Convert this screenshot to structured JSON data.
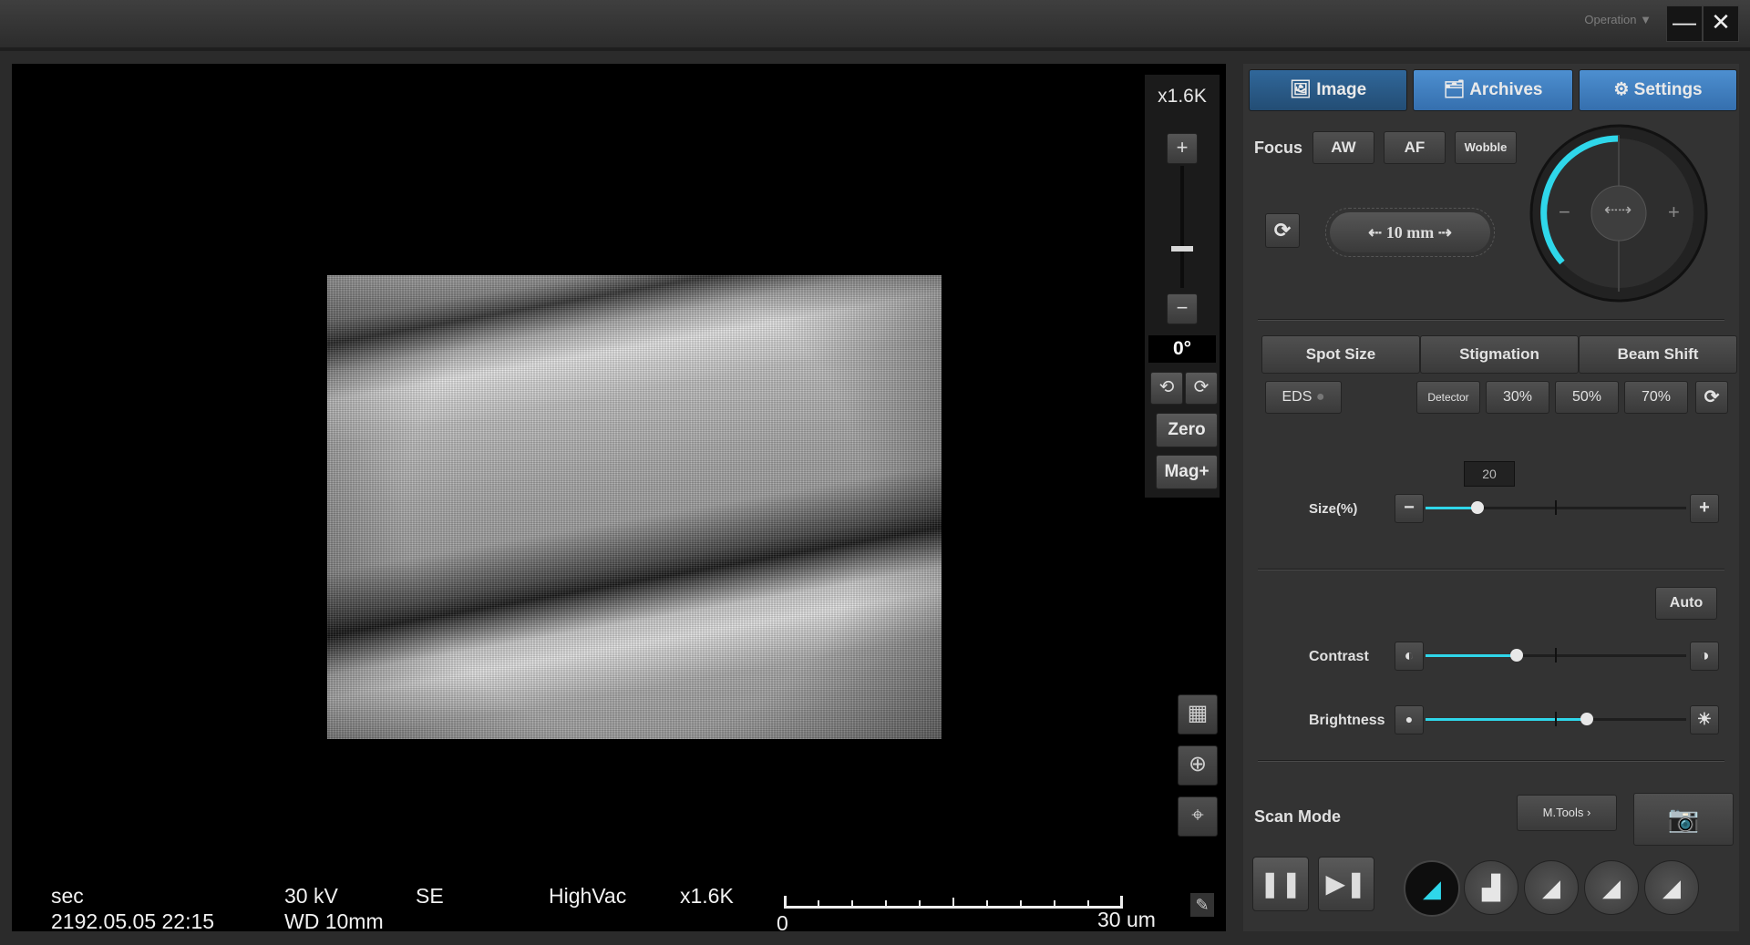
{
  "titlebar": {
    "operation_label": "Operation",
    "minimize_symbol": "—",
    "close_symbol": "✕"
  },
  "zoom": {
    "magnification": "x1.6K",
    "plus": "+",
    "minus": "−",
    "rotation": "0°",
    "zero_label": "Zero",
    "magplus_label": "Mag+"
  },
  "status": {
    "scan_speed": "sec",
    "datetime": "2192.05.05 22:15",
    "voltage": "30 kV",
    "working_distance": "WD 10mm",
    "detector": "SE",
    "vacuum": "HighVac",
    "magnification": "x1.6K",
    "scale_start": "0",
    "scale_end": "30 um"
  },
  "tabs": [
    {
      "label": "Image",
      "icon": "image-icon",
      "active": true
    },
    {
      "label": "Archives",
      "icon": "archives-icon",
      "active": false
    },
    {
      "label": "Settings",
      "icon": "gear-icon",
      "active": false
    }
  ],
  "focus": {
    "label": "Focus",
    "aw": "AW",
    "af": "AF",
    "wobble": "Wobble",
    "distance": "10 mm",
    "dial_minus": "−",
    "dial_plus": "+"
  },
  "beam_tabs": [
    "Spot Size",
    "Stigmation",
    "Beam Shift"
  ],
  "presets": {
    "eds": "EDS",
    "detector": "Detector",
    "p30": "30%",
    "p50": "50%",
    "p70": "70%"
  },
  "size_slider": {
    "label": "Size(%)",
    "value": "20",
    "fraction": 0.2
  },
  "contrast": {
    "label": "Contrast",
    "fraction": 0.35,
    "auto_label": "Auto"
  },
  "brightness": {
    "label": "Brightness",
    "fraction": 0.62
  },
  "scan": {
    "label": "Scan Mode",
    "mtools_label": "M.Tools"
  },
  "colors": {
    "accent": "#2fd7ea",
    "tab_active": "#2b5e8e",
    "tab_inactive": "#3a78b4"
  }
}
